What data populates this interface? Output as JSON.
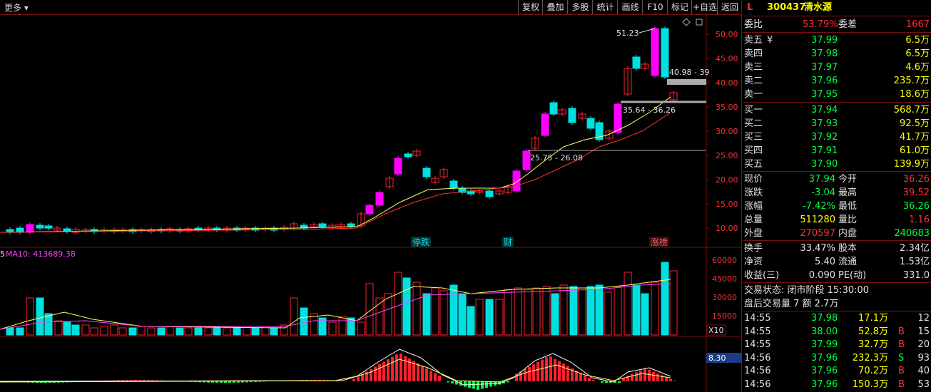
{
  "toolbar": {
    "more": "更多",
    "buttons": [
      "复权",
      "叠加",
      "多股",
      "统计",
      "画线",
      "F10",
      "标记",
      "+自选",
      "返回"
    ]
  },
  "price_axis": [
    "50.00",
    "45.00",
    "40.00",
    "35.00",
    "30.00",
    "25.00",
    "20.00",
    "15.00",
    "10.00"
  ],
  "volume_axis": [
    "60000",
    "45000",
    "30000",
    "15000"
  ],
  "volume_multiplier": "X10",
  "macd_value": "8.30",
  "annotations": {
    "high": "51.23",
    "range1": "40.98 - 39",
    "range2": "35.64 - 36.26",
    "range3": "25.75 - 26.08",
    "mark1": "停跌",
    "mark2": "财",
    "mark3": "涨榜"
  },
  "ma_label_prefix": "5",
  "ma10_label": "MA10: 413689.38",
  "stock": {
    "flag": "L",
    "code": "300437",
    "name": "清水源"
  },
  "order_ratio": {
    "label1": "委比",
    "value1": "53.79%",
    "label2": "委差",
    "value2": "1667"
  },
  "asks": [
    {
      "label": "卖五",
      "mark": "¥",
      "price": "37.99",
      "vol": "6.5万"
    },
    {
      "label": "卖四",
      "mark": "",
      "price": "37.98",
      "vol": "6.5万"
    },
    {
      "label": "卖三",
      "mark": "",
      "price": "37.97",
      "vol": "4.6万"
    },
    {
      "label": "卖二",
      "mark": "",
      "price": "37.96",
      "vol": "235.7万"
    },
    {
      "label": "卖一",
      "mark": "",
      "price": "37.95",
      "vol": "18.6万"
    }
  ],
  "bids": [
    {
      "label": "买一",
      "price": "37.94",
      "vol": "568.7万"
    },
    {
      "label": "买二",
      "price": "37.93",
      "vol": "92.5万"
    },
    {
      "label": "买三",
      "price": "37.92",
      "vol": "41.7万"
    },
    {
      "label": "买四",
      "price": "37.91",
      "vol": "61.0万"
    },
    {
      "label": "买五",
      "price": "37.90",
      "vol": "139.9万"
    }
  ],
  "stats": [
    {
      "l1": "现价",
      "v1": "37.94",
      "l2": "今开",
      "v2": "36.26"
    },
    {
      "l1": "涨跌",
      "v1": "-3.04",
      "l2": "最高",
      "v2": "39.52"
    },
    {
      "l1": "涨幅",
      "v1": "-7.42%",
      "l2": "最低",
      "v2": "36.26"
    },
    {
      "l1": "总量",
      "v1": "511280",
      "l2": "量比",
      "v2": "1.16"
    },
    {
      "l1": "外盘",
      "v1": "270597",
      "l2": "内盘",
      "v2": "240683"
    }
  ],
  "stats2": [
    {
      "l1": "换手",
      "v1": "33.47%",
      "l2": "股本",
      "v2": "2.34亿"
    },
    {
      "l1": "净资",
      "v1": "5.40",
      "l2": "流通",
      "v2": "1.53亿"
    },
    {
      "l1": "收益(三)",
      "v1": "0.090",
      "l2": "PE(动)",
      "v2": "331.0"
    }
  ],
  "status": {
    "line1": "交易状态: 闭市阶段 15:30:00",
    "line2": "盘后交易量 7 额 2.7万"
  },
  "ticks": [
    {
      "t": "14:55",
      "p": "37.98",
      "v": "17.1万",
      "s": "",
      "n": "12"
    },
    {
      "t": "14:55",
      "p": "38.00",
      "v": "52.8万",
      "s": "B",
      "n": "15"
    },
    {
      "t": "14:55",
      "p": "37.99",
      "v": "32.7万",
      "s": "B",
      "n": "20"
    },
    {
      "t": "14:56",
      "p": "37.96",
      "v": "232.3万",
      "s": "S",
      "n": "93"
    },
    {
      "t": "14:56",
      "p": "37.96",
      "v": "70.2万",
      "s": "B",
      "n": "40"
    },
    {
      "t": "14:56",
      "p": "37.96",
      "v": "150.3万",
      "s": "B",
      "n": "53"
    }
  ],
  "colors": {
    "up": "#ff2030",
    "down": "#00e0e0",
    "limit_up": "#ff00ff",
    "label": "#e0e0e0",
    "yellow": "#ffff00",
    "border": "#7a1010"
  }
}
